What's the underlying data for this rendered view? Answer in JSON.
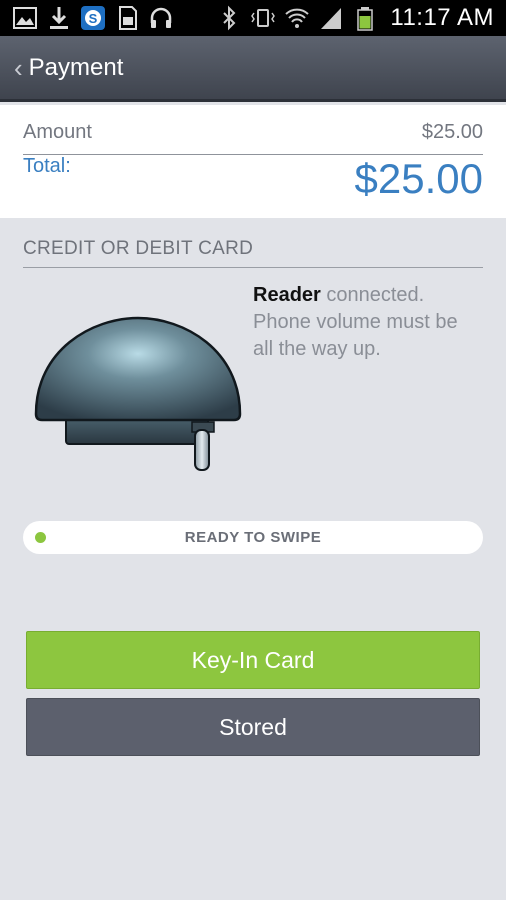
{
  "status_bar": {
    "time": "11:17 AM",
    "icons_left": [
      "image-icon",
      "download-icon",
      "skype-icon",
      "sd-card-icon",
      "headphones-icon"
    ],
    "icons_right": [
      "bluetooth-icon",
      "vibrate-icon",
      "wifi-icon",
      "signal-icon",
      "battery-icon"
    ],
    "accent": "#8cc63f"
  },
  "action_bar": {
    "title": "Payment"
  },
  "amount": {
    "label": "Amount",
    "value": "$25.00"
  },
  "total": {
    "label": "Total:",
    "value": "$25.00",
    "color": "#3a7fc1"
  },
  "card_section": {
    "title": "CREDIT OR DEBIT CARD",
    "reader_word": "Reader",
    "status_rest": " connected. Phone volume must be all the way up.",
    "swipe_status": "READY TO SWIPE"
  },
  "buttons": {
    "keyin_label": "Key-In Card",
    "stored_label": "Stored",
    "keyin_color": "#8dc63f",
    "stored_color": "#5c606d"
  }
}
